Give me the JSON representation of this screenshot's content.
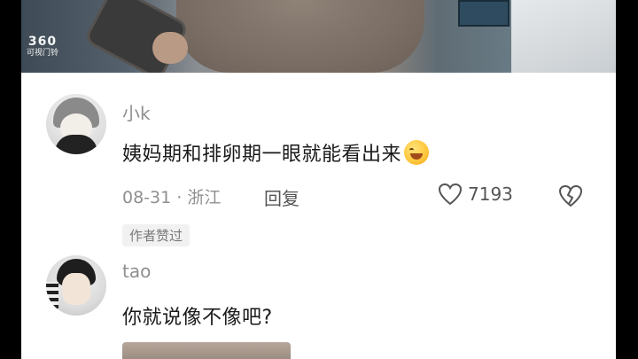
{
  "video": {
    "watermark_line1": "360",
    "watermark_line2": "可视门铃"
  },
  "comments": [
    {
      "username": "小k",
      "text": "姨妈期和排卵期一眼就能看出来",
      "emoji": "grinning-sweat-emoji",
      "meta": "08-31 · 浙江",
      "reply_label": "回复",
      "like_count": "7193",
      "badge": "作者赞过"
    },
    {
      "username": "tao",
      "text": "你就说像不像吧?"
    }
  ],
  "icons": {
    "like": "heart-outline-icon",
    "dislike": "broken-heart-icon"
  },
  "colors": {
    "background": "#ffffff",
    "meta_text": "#8f8f8f",
    "body_text": "#1a1a1a"
  }
}
